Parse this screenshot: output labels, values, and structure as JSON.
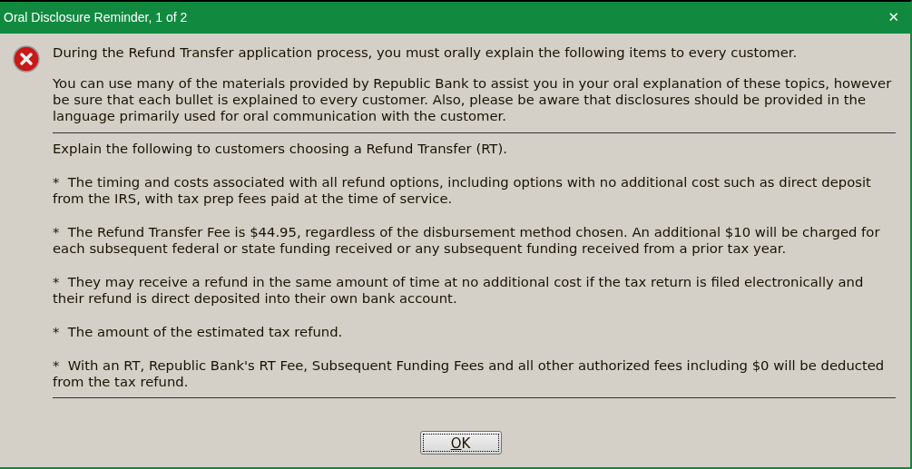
{
  "window": {
    "title": "Oral Disclosure Reminder, 1 of 2",
    "close": "✕"
  },
  "intro": [
    "During the Refund Transfer application process, you must orally explain the following items to every customer.",
    "You can use many of the materials provided by Republic Bank to assist you in your oral explanation of these topics, however be sure that each bullet is explained to every customer. Also, please be aware that disclosures should be provided in the language primarily used for oral communication with the customer."
  ],
  "details": {
    "heading": "Explain the following to customers choosing a Refund Transfer (RT).",
    "bullets": [
      "*  The timing and costs associated with all refund options, including options with no additional cost such as direct deposit from the IRS, with tax prep fees paid at the time of service.",
      "*  The Refund Transfer Fee is $44.95, regardless of the disbursement method chosen. An additional $10 will be charged for each subsequent federal or state funding received or any subsequent funding received from a prior tax year.",
      "*  They may receive a refund in the same amount of time at no additional cost if the tax return is filed electronically and their refund is direct deposited into their own bank account.",
      "*  The amount of the estimated tax refund.",
      "*  With an RT, Republic Bank's RT Fee, Subsequent Funding Fees and all other authorized fees including $0 will be deducted from the tax refund."
    ]
  },
  "buttons": [
    {
      "label": "OK",
      "mnemonic": true,
      "focused": true
    }
  ]
}
